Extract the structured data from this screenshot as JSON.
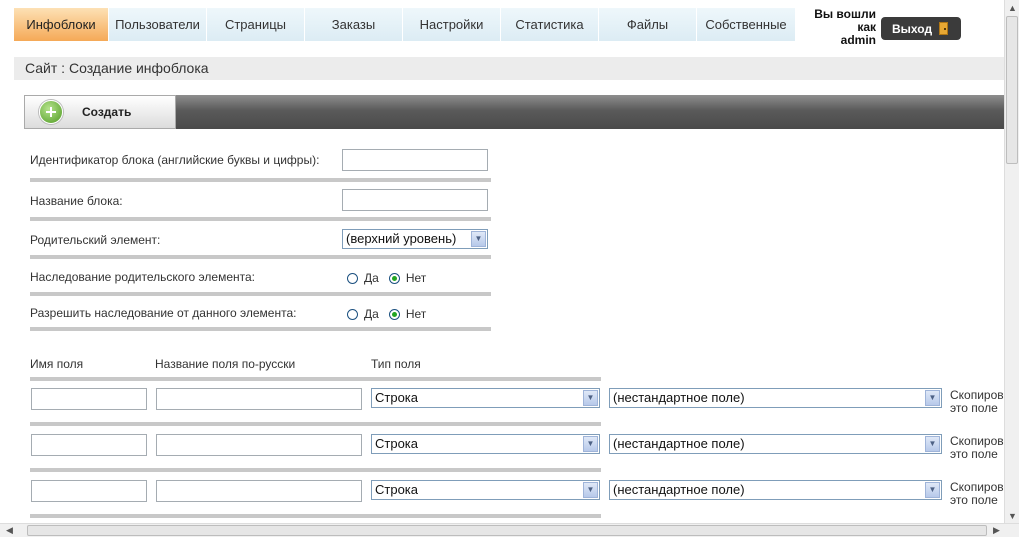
{
  "nav": {
    "tabs": [
      {
        "label": "Инфоблоки",
        "active": true
      },
      {
        "label": "Пользователи",
        "active": false
      },
      {
        "label": "Страницы",
        "active": false
      },
      {
        "label": "Заказы",
        "active": false
      },
      {
        "label": "Настройки",
        "active": false
      },
      {
        "label": "Статистика",
        "active": false
      },
      {
        "label": "Файлы",
        "active": false
      },
      {
        "label": "Собственные",
        "active": false
      }
    ],
    "user_line1": "Вы вошли",
    "user_line2": "как",
    "user_line3": "admin",
    "logout_label": "Выход"
  },
  "breadcrumb": "Сайт : Создание инфоблока",
  "toolbar": {
    "create_label": "Создать"
  },
  "form": {
    "block_id_label": "Идентификатор блока (английские буквы и цифры):",
    "block_id_value": "",
    "block_name_label": "Название блока:",
    "block_name_value": "",
    "parent_label": "Родительский элемент:",
    "parent_value": "(верхний уровень)",
    "inherit_parent_label": "Наследование родительского элемента:",
    "allow_inherit_label": "Разрешить наследование от данного элемента:",
    "yes_label": "Да",
    "no_label": "Нет",
    "inherit_parent_selected": "Нет",
    "allow_inherit_selected": "Нет"
  },
  "fields_table": {
    "col_field_name": "Имя поля",
    "col_field_title": "Название поля по-русски",
    "col_field_type": "Тип поля",
    "rows": [
      {
        "name": "",
        "title": "",
        "type": "Строка",
        "preset": "(нестандартное поле)",
        "copy_line1": "Скопиров",
        "copy_line2": "это поле"
      },
      {
        "name": "",
        "title": "",
        "type": "Строка",
        "preset": "(нестандартное поле)",
        "copy_line1": "Скопиров",
        "copy_line2": "это поле"
      },
      {
        "name": "",
        "title": "",
        "type": "Строка",
        "preset": "(нестандартное поле)",
        "copy_line1": "Скопиров",
        "copy_line2": "это поле"
      }
    ]
  },
  "colors": {
    "active_tab": "#f5a957",
    "tab_bg": "#dcecf4",
    "toolbar": "#5a5a5a",
    "separator": "#c8c8c8"
  }
}
